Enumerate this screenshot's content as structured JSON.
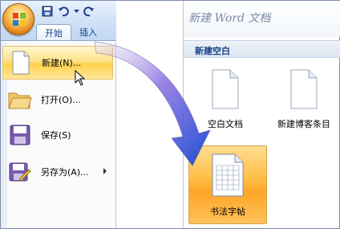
{
  "ribbon": {
    "tabs": [
      {
        "label": "开始"
      },
      {
        "label": "插入"
      }
    ]
  },
  "office_menu": {
    "items": [
      {
        "label": "新建(N)..."
      },
      {
        "label": "打开(O)..."
      },
      {
        "label": "保存(S)"
      },
      {
        "label": "另存为(A)..."
      }
    ]
  },
  "new_doc_panel": {
    "title": "新建 Word 文档",
    "section": "新建空白",
    "templates": [
      {
        "label": "空白文档"
      },
      {
        "label": "新建博客条目"
      },
      {
        "label": "书法字帖"
      }
    ]
  },
  "colors": {
    "accent": "#15428b",
    "highlight": "#ffd24d",
    "arrow": "#5a46c8"
  }
}
